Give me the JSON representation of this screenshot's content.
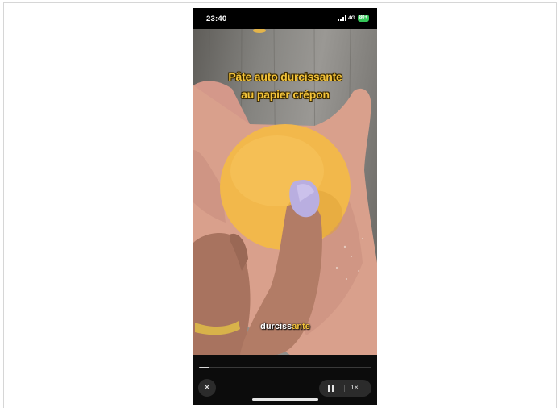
{
  "status_bar": {
    "time": "23:40",
    "network": "4G",
    "battery": "80+"
  },
  "video": {
    "title_line_1": "Pâte auto durcissante",
    "title_line_2": "au papier crépon",
    "caption_white": "durciss",
    "caption_yellow": "ante"
  },
  "controls": {
    "progress": 0.06,
    "close_icon": "✕",
    "speed": "1×"
  },
  "colors": {
    "caption_accent": "#f3c33a",
    "battery": "#35c759"
  }
}
